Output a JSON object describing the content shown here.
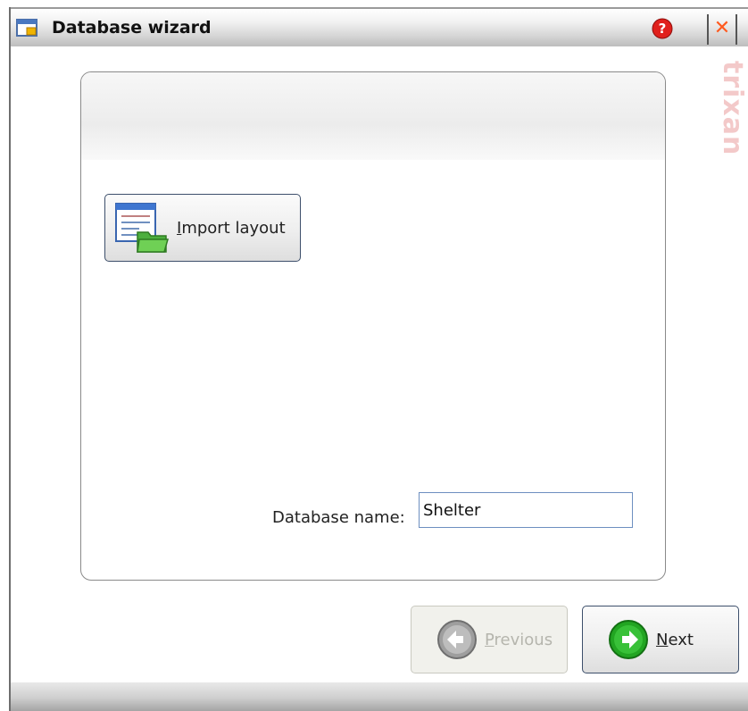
{
  "window": {
    "title": "Database wizard",
    "watermark": "trixan",
    "close_glyph": "✕"
  },
  "wizard": {
    "import_button": {
      "label_accel": "I",
      "label_rest": "mport layout"
    },
    "database_name": {
      "label": "Database name:",
      "value": "Shelter"
    }
  },
  "footer": {
    "previous": {
      "label_accel": "P",
      "label_rest": "revious",
      "enabled": false
    },
    "next": {
      "label_accel": "N",
      "label_rest": "ext",
      "enabled": true
    }
  },
  "icons": {
    "title": "database-window-icon",
    "help": "help-icon",
    "close": "close-icon",
    "import": "import-layout-icon",
    "previous": "back-arrow-icon",
    "next": "forward-arrow-icon"
  },
  "colors": {
    "help_red": "#e0201c",
    "close_orange": "#ff5a1f",
    "next_green": "#22a522",
    "previous_gray": "#a8a8a8"
  }
}
